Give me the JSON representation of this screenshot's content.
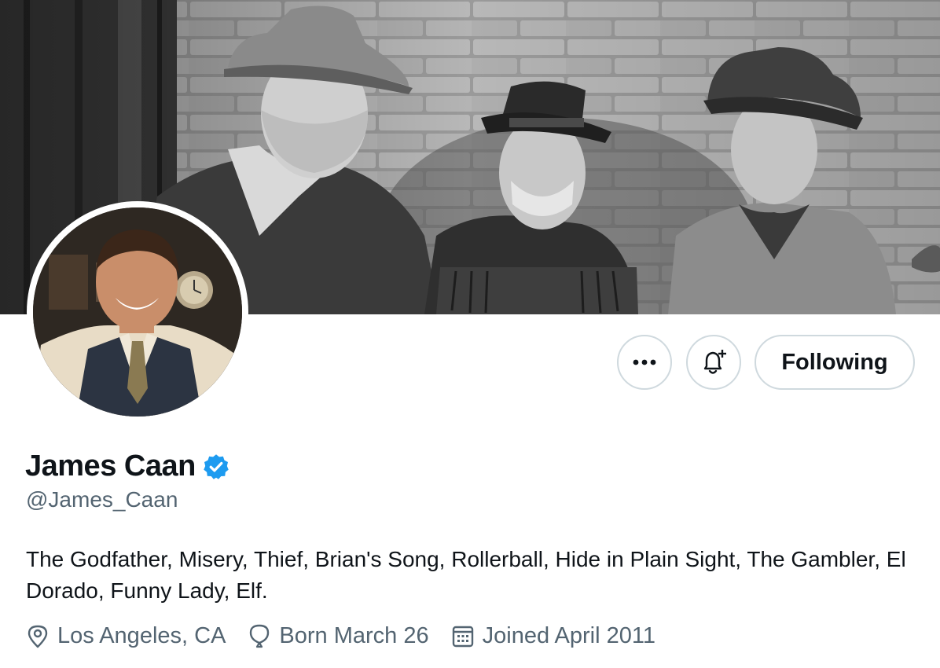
{
  "profile": {
    "name": "James Caan",
    "handle": "@James_Caan",
    "bio": "The Godfather, Misery, Thief, Brian's Song, Rollerball, Hide in Plain Sight, The Gambler, El Dorado, Funny Lady, Elf.",
    "location": "Los Angeles, CA",
    "birthday": "Born March 26",
    "joined": "Joined April 2011",
    "verified": true
  },
  "actions": {
    "more_label": "•••",
    "following_label": "Following"
  },
  "icons": {
    "verified": "verified-badge-icon",
    "location": "location-pin-icon",
    "birthday": "balloon-icon",
    "joined": "calendar-icon",
    "notify": "bell-plus-icon",
    "more": "more-dots-icon"
  },
  "colors": {
    "verified": "#1d9bf0",
    "text_primary": "#0f1419",
    "text_secondary": "#536471",
    "border": "#cfd9de"
  }
}
